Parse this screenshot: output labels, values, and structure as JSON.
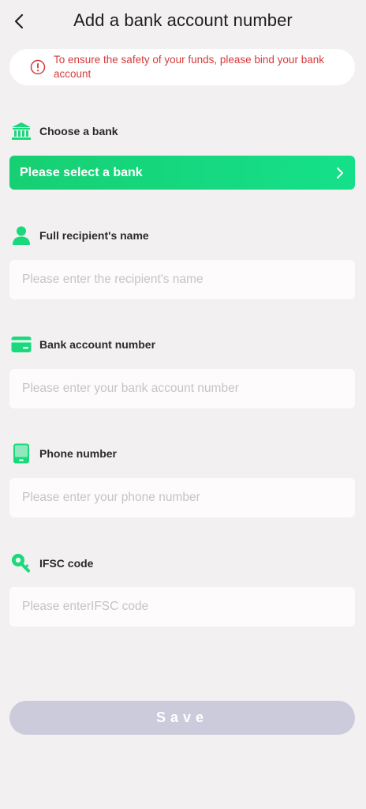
{
  "header": {
    "title": "Add a bank account number",
    "back_icon": "chevron-left-icon"
  },
  "notice": {
    "text": "To ensure the safety of your funds, please bind your bank account",
    "icon": "alert-circle-icon",
    "color": "#d63a3a"
  },
  "bank": {
    "label": "Choose a bank",
    "icon": "bank-icon",
    "select_text": "Please select a bank",
    "gradient_start": "#17cf73",
    "gradient_end": "#15e08a"
  },
  "recipient": {
    "label": "Full recipient's name",
    "icon": "user-icon",
    "placeholder": "Please enter the recipient's name",
    "value": ""
  },
  "account": {
    "label": "Bank account number",
    "icon": "card-icon",
    "placeholder": "Please enter your bank account number",
    "value": ""
  },
  "phone": {
    "label": "Phone number",
    "icon": "phone-icon",
    "placeholder": "Please enter your phone number",
    "value": ""
  },
  "ifsc": {
    "label": "IFSC code",
    "icon": "key-icon",
    "placeholder": "Please enterIFSC code",
    "value": ""
  },
  "save": {
    "label": "Save",
    "color": "#cccbdb"
  },
  "colors": {
    "accent": "#1ad97d",
    "background": "#f2f0f1"
  }
}
